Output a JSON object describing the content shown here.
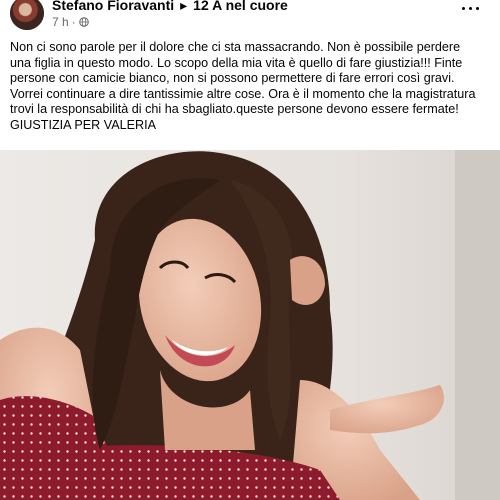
{
  "post": {
    "author": "Stefano Fioravanti",
    "separator": "▸",
    "group": "12 A nel cuore",
    "time": "7 h",
    "dot": "·",
    "text_lines": [
      "Non ci sono parole per il dolore che ci sta massacrando. Non è possibile perdere",
      "una figlia in questo modo. Lo scopo della mia vita è quello di fare giustizia!!! Finte",
      "persone con camicie bianco, non si  possono permettere di fare errori così gravi.",
      "Vorrei continuare a dire tantissimie altre cose. Ora è il momento che la magistratura",
      "trovi la responsabilità di chi ha sbagliato.queste persone devono essere fermate!",
      "GIUSTIZIA PER VALERIA"
    ]
  },
  "colors": {
    "text": "#050505",
    "meta": "#65676b",
    "dress": "#8e1b2b",
    "hair": "#3a2419",
    "skin": "#e8b9a3",
    "background": "#e8e3de"
  }
}
